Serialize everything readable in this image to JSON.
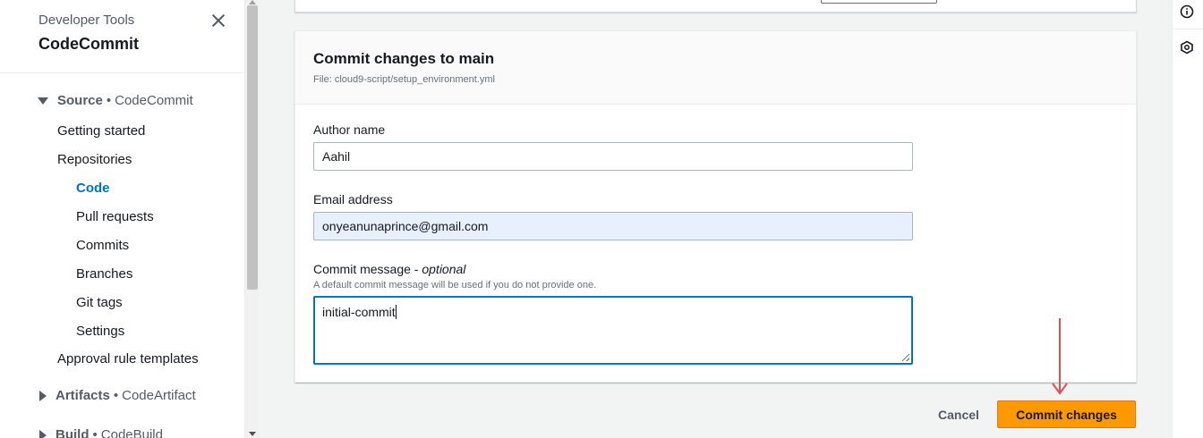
{
  "sidebar": {
    "service_group": "Developer Tools",
    "service_name": "CodeCommit",
    "sections": [
      {
        "name": "Source",
        "suffix": "CodeCommit",
        "expanded": true
      },
      {
        "name": "Artifacts",
        "suffix": "CodeArtifact",
        "expanded": false
      },
      {
        "name": "Build",
        "suffix": "CodeBuild",
        "expanded": false
      }
    ],
    "items": {
      "getting_started": "Getting started",
      "repositories": "Repositories",
      "code": "Code",
      "pull_requests": "Pull requests",
      "commits": "Commits",
      "branches": "Branches",
      "git_tags": "Git tags",
      "settings": "Settings",
      "approval_rule_templates": "Approval rule templates"
    },
    "separator": "•"
  },
  "commit_form": {
    "title": "Commit changes to main",
    "file_label": "File: cloud9-script/setup_environment.yml",
    "author_label": "Author name",
    "author_value": "Aahil",
    "email_label": "Email address",
    "email_value": "onyeanunaprince@gmail.com",
    "message_label": "Commit message - ",
    "message_optional": "optional",
    "message_hint": "A default commit message will be used if you do not provide one.",
    "message_value": "initial-commit"
  },
  "actions": {
    "cancel_label": "Cancel",
    "commit_label": "Commit changes"
  },
  "colors": {
    "primary_button": "#ff9900",
    "link_active": "#0073bb",
    "annotation_arrow": "#e0504f",
    "autofill_bg": "#e8f0fe"
  },
  "right_rail": {
    "icons": [
      "info-icon",
      "hexagon-icon"
    ]
  }
}
